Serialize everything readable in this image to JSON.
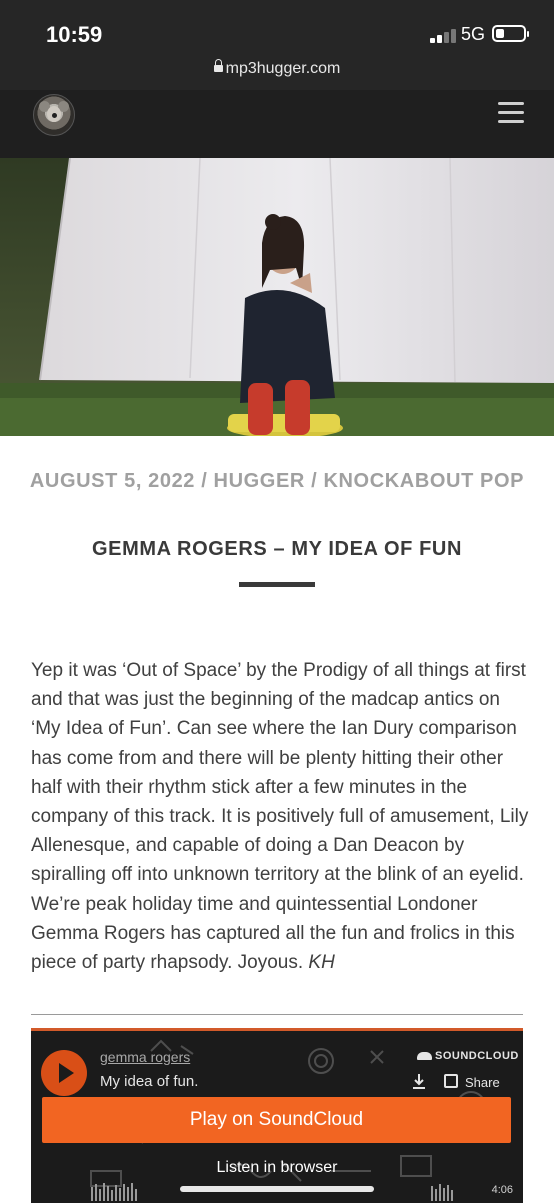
{
  "status_bar": {
    "time": "10:59",
    "network": "5G"
  },
  "browser": {
    "url": "mp3hugger.com"
  },
  "site": {
    "logo_icon": "koala-logo-icon",
    "menu_icon": "hamburger-menu-icon"
  },
  "post": {
    "date": "AUGUST 5, 2022",
    "separator": "/",
    "author": "HUGGER",
    "category": "KNOCKABOUT POP",
    "title": "GEMMA ROGERS – MY IDEA OF FUN",
    "body": "Yep it was ‘Out of Space’ by the Prodigy of all things at first and that was just the beginning of the madcap antics on ‘My Idea of Fun’. Can see where the Ian Dury comparison has come from and there will be plenty hitting their other half with their rhythm stick after a few minutes in the company of this track. It is positively full of amusement, Lily Allenesque, and capable of doing a Dan Deacon by spiralling off into unknown territory at the blink of an eyelid. We’re peak holiday time and quintessential Londoner Gemma Rogers has captured all the fun and frolics in this piece of party rhapsody. Joyous.",
    "signature": "KH"
  },
  "soundcloud": {
    "artist": "gemma rogers",
    "track": "My idea of fun.",
    "brand": "SOUNDCLOUD",
    "share_label": "Share",
    "play_button": "Play on SoundCloud",
    "listen_link": "Listen in browser",
    "duration": "4:06",
    "accent_color": "#f26522"
  }
}
